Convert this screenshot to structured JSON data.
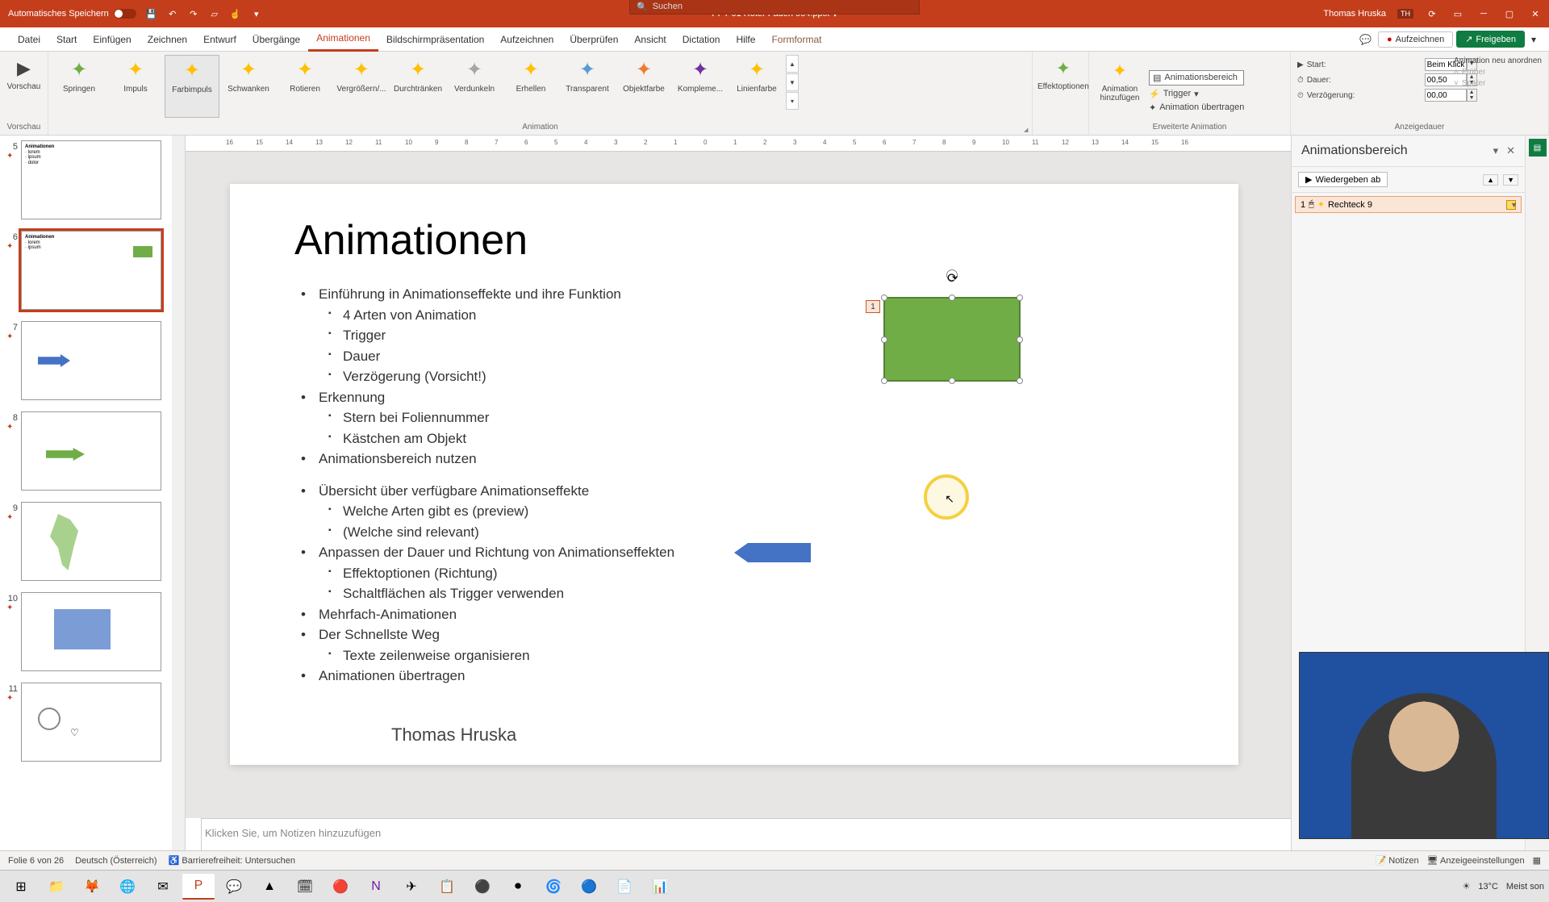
{
  "titlebar": {
    "autosave_label": "Automatisches Speichern",
    "filename": "PPT 01 Roter Faden 004.pptx",
    "search_placeholder": "Suchen",
    "user_name": "Thomas Hruska",
    "user_initials": "TH"
  },
  "tabs": {
    "datei": "Datei",
    "start": "Start",
    "einfuegen": "Einfügen",
    "zeichnen": "Zeichnen",
    "entwurf": "Entwurf",
    "uebergaenge": "Übergänge",
    "animationen": "Animationen",
    "bildschirm": "Bildschirmpräsentation",
    "aufzeichnen": "Aufzeichnen",
    "ueberpruefen": "Überprüfen",
    "ansicht": "Ansicht",
    "dictation": "Dictation",
    "hilfe": "Hilfe",
    "formformat": "Formformat",
    "aufzeichnen_btn": "Aufzeichnen",
    "freigeben": "Freigeben"
  },
  "ribbon": {
    "vorschau": "Vorschau",
    "vorschau_grp": "Vorschau",
    "animation_grp": "Animation",
    "erweiterte_grp": "Erweiterte Animation",
    "anzeigedauer_grp": "Anzeigedauer",
    "effects": [
      "Springen",
      "Impuls",
      "Farbimpuls",
      "Schwanken",
      "Rotieren",
      "Vergrößern/...",
      "Durchtränken",
      "Verdunkeln",
      "Erhellen",
      "Transparent",
      "Objektfarbe",
      "Kompleme...",
      "Linienfarbe"
    ],
    "effektoptionen": "Effektoptionen",
    "anim_hinzu": "Animation hinzufügen",
    "anim_bereich": "Animationsbereich",
    "trigger": "Trigger",
    "anim_uebertragen": "Animation übertragen",
    "start_label": "Start:",
    "start_val": "Beim Klicken",
    "dauer_label": "Dauer:",
    "dauer_val": "00,50",
    "verz_label": "Verzögerung:",
    "verz_val": "00,00",
    "neu_anordnen": "Animation neu anordnen",
    "frueher": "Früher",
    "spaeter": "Später"
  },
  "thumbs": [
    {
      "num": "5",
      "title": "Animationen"
    },
    {
      "num": "6",
      "title": "Animationen"
    },
    {
      "num": "7",
      "title": ""
    },
    {
      "num": "8",
      "title": ""
    },
    {
      "num": "9",
      "title": ""
    },
    {
      "num": "10",
      "title": ""
    },
    {
      "num": "11",
      "title": ""
    }
  ],
  "slide": {
    "title": "Animationen",
    "b1": "Einführung in Animationseffekte und ihre Funktion",
    "b1a": "4 Arten von Animation",
    "b1b": "Trigger",
    "b1c": "Dauer",
    "b1d": "Verzögerung (Vorsicht!)",
    "b2": "Erkennung",
    "b2a": "Stern bei Foliennummer",
    "b2b": "Kästchen am Objekt",
    "b3": "Animationsbereich nutzen",
    "b4": "Übersicht über verfügbare Animationseffekte",
    "b4a": "Welche Arten gibt es (preview)",
    "b4b": "(Welche sind relevant)",
    "b5": "Anpassen der Dauer und Richtung von Animationseffekten",
    "b5a": "Effektoptionen (Richtung)",
    "b5b": "Schaltflächen als Trigger verwenden",
    "b6": "Mehrfach-Animationen",
    "b7": "Der Schnellste Weg",
    "b7a": "Texte zeilenweise organisieren",
    "b8": "Animationen übertragen",
    "author": "Thomas Hruska",
    "anim_num": "1"
  },
  "notes": {
    "placeholder": "Klicken Sie, um Notizen hinzuzufügen"
  },
  "anim_pane": {
    "title": "Animationsbereich",
    "play": "Wiedergeben ab",
    "item_num": "1",
    "item_name": "Rechteck 9"
  },
  "status": {
    "slide_info": "Folie 6 von 26",
    "lang": "Deutsch (Österreich)",
    "access": "Barrierefreiheit: Untersuchen",
    "notizen": "Notizen",
    "anzeige": "Anzeigeeinstellungen"
  },
  "taskbar": {
    "weather_temp": "13°C",
    "weather_txt": "Meist son"
  },
  "ruler_marks": [
    "16",
    "15",
    "14",
    "13",
    "12",
    "11",
    "10",
    "9",
    "8",
    "7",
    "6",
    "5",
    "4",
    "3",
    "2",
    "1",
    "0",
    "1",
    "2",
    "3",
    "4",
    "5",
    "6",
    "7",
    "8",
    "9",
    "10",
    "11",
    "12",
    "13",
    "14",
    "15",
    "16"
  ]
}
